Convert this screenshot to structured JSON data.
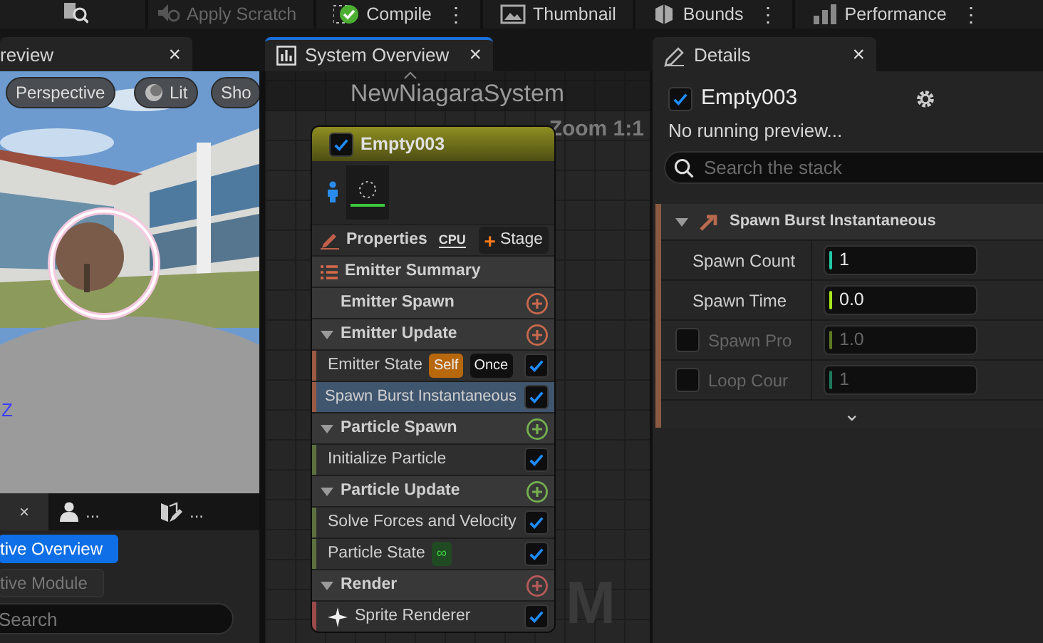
{
  "toolbar": [
    {
      "label": "Apply Scratch",
      "disabled": true
    },
    {
      "label": "Compile",
      "disabled": false,
      "more": "⋮"
    },
    {
      "label": "Thumbnail",
      "disabled": false
    },
    {
      "label": "Bounds",
      "disabled": false,
      "more": "⋮"
    },
    {
      "label": "Performance",
      "disabled": false,
      "more": "⋮"
    }
  ],
  "tabs": [
    {
      "label": "review",
      "close": "×",
      "selected": false
    },
    {
      "label": "System Overview",
      "close": "×",
      "selected": true
    },
    {
      "label": "Details",
      "close": "×",
      "selected": false
    }
  ],
  "viewport": {
    "buttons": [
      "Perspective",
      "Lit",
      "Sho"
    ],
    "axis_label": "Z"
  },
  "left_tabs": [
    {
      "close": "×",
      "selected": true
    },
    {
      "label": "...",
      "selected": false
    },
    {
      "label": "...",
      "selected": false
    }
  ],
  "left_buttons": [
    {
      "label": "tive Overview",
      "selected": true
    },
    {
      "label": "tive Module",
      "selected": false
    }
  ],
  "left_search": {
    "placeholder": "Search"
  },
  "graph": {
    "title": "NewNiagaraSystem",
    "zoom": "Zoom 1:1",
    "watermark": "M"
  },
  "node": {
    "enabled": true,
    "name": "Empty003",
    "properties": "Properties",
    "sim_target": "CPU",
    "stage_icon": "+",
    "stage": "Stage",
    "items": [
      {
        "kind": "summary",
        "label": "Emitter Summary"
      },
      {
        "kind": "section",
        "label": "Emitter Spawn",
        "expanded": false,
        "color": "#c8694c"
      },
      {
        "kind": "section",
        "label": "Emitter Update",
        "expanded": true,
        "color": "#c8694c"
      },
      {
        "kind": "module",
        "label": "Emitter State",
        "enabled": true,
        "selected": false,
        "color": "#9a5a44",
        "tags": [
          {
            "text": "Self",
            "color": "#b8680c"
          },
          {
            "text": "Once",
            "color": "#101010"
          }
        ]
      },
      {
        "kind": "module",
        "label": "Spawn Burst Instantaneous",
        "enabled": true,
        "selected": true,
        "color": "#9a5a44"
      },
      {
        "kind": "section",
        "label": "Particle Spawn",
        "expanded": true,
        "color": "#74b050"
      },
      {
        "kind": "module",
        "label": "Initialize Particle",
        "enabled": true,
        "selected": false,
        "color": "#5c7040"
      },
      {
        "kind": "section",
        "label": "Particle Update",
        "expanded": true,
        "color": "#74b050"
      },
      {
        "kind": "module",
        "label": "Solve Forces and Velocity",
        "enabled": true,
        "selected": false,
        "color": "#5c7040"
      },
      {
        "kind": "module",
        "label": "Particle State",
        "enabled": true,
        "selected": false,
        "color": "#5c7040",
        "tags": [
          {
            "text": "∞",
            "color": "#1f4a22"
          }
        ]
      },
      {
        "kind": "section",
        "label": "Render",
        "expanded": true,
        "color": "#b85a5a"
      },
      {
        "kind": "renderer",
        "label": "Sprite Renderer",
        "enabled": true,
        "selected": false,
        "color": "#9a4a4a"
      }
    ]
  },
  "details": {
    "enabled": true,
    "name": "Empty003",
    "status": "No running preview...",
    "search_placeholder": "Search the stack",
    "module": {
      "label": "Spawn Burst Instantaneous",
      "expanded": true
    },
    "params": [
      {
        "kind": "required",
        "label": "Spawn Count",
        "value": "1",
        "color": "#22c7a6"
      },
      {
        "kind": "required",
        "label": "Spawn Time",
        "value": "0.0",
        "color": "#a8e81e"
      },
      {
        "kind": "optional",
        "label": "Spawn Pro",
        "value": "1.0",
        "color": "#5d7a22",
        "checked": false
      },
      {
        "kind": "optional",
        "label": "Loop Cour",
        "value": "1",
        "color": "#1d7a5c",
        "checked": false
      }
    ],
    "more": "⌄"
  }
}
